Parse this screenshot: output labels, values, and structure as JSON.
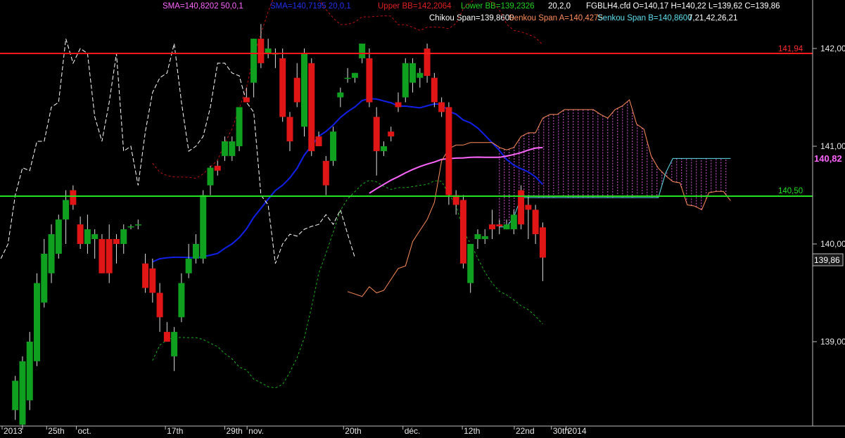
{
  "header": {
    "sma50": "SMA=140,8202  50,0,1",
    "sma20": "SMA=140,7195  20,0,1",
    "upper_bb": "Upper BB=142,2064",
    "lower_bb": "Lower BB=139,2326",
    "bb_params": "20,2,0",
    "instrument": "FGBLH4.cfd O=140,17 H=140,22 L=139,62 C=139,86",
    "chikou": "Chikou Span=139,8600",
    "senkou_a": "Senkou Span A=140,4275",
    "senkou_b": "Senkou Span B=140,8600",
    "ichimoku_params": "7,21,42,26,21"
  },
  "price_tags": {
    "red_line": "141,94",
    "green_line": "140,50",
    "sma_value": "140,82",
    "last_close": "139,86"
  },
  "colors": {
    "background": "#000000",
    "bull": "#10a020",
    "bear": "#e01515",
    "sma20": "#1020e8",
    "sma50": "#ff66ff",
    "upper_bb": "#c01010",
    "lower_bb": "#16b016",
    "chikou": "#ffffff",
    "senkou_a": "#ff8c5a",
    "senkou_b": "#5ee0ee",
    "cloud": "#ff66ff",
    "red_hline": "#ff1a1a",
    "green_hline": "#22e022"
  },
  "chart_data": {
    "type": "candlestick",
    "instrument": "FGBLH4.cfd",
    "y_range": [
      138.35,
      142.5
    ],
    "y_ticks": [
      {
        "value": 142.0,
        "label": "142,00"
      },
      {
        "value": 141.0,
        "label": "141,00"
      },
      {
        "value": 140.0,
        "label": "140,00"
      },
      {
        "value": 139.0,
        "label": "139,00"
      }
    ],
    "x_ticks": [
      {
        "date": "2013-09-17",
        "label": "2013"
      },
      {
        "date": "2013-09-25",
        "label": "25th"
      },
      {
        "date": "2013-10-01",
        "label": "oct."
      },
      {
        "date": "2013-10-17",
        "label": "17th"
      },
      {
        "date": "2013-10-29",
        "label": "29th"
      },
      {
        "date": "2013-11-01",
        "label": "nov."
      },
      {
        "date": "2013-11-20",
        "label": "20th"
      },
      {
        "date": "2013-12-02",
        "label": "déc."
      },
      {
        "date": "2013-12-12",
        "label": "12th"
      },
      {
        "date": "2013-12-22",
        "label": "22nd"
      },
      {
        "date": "2013-12-30",
        "label": "30th"
      },
      {
        "date": "2014-01-01",
        "label": "2014"
      }
    ],
    "hlines": [
      {
        "value": 141.94,
        "label": "141,94",
        "color": "red"
      },
      {
        "value": 140.5,
        "label": "140,50",
        "color": "green"
      }
    ],
    "last_sma_value": 140.82,
    "last_close": 139.86,
    "candles": [
      {
        "o": 138.3,
        "h": 138.65,
        "l": 138.2,
        "c": 138.6
      },
      {
        "o": 138.15,
        "h": 138.85,
        "l": 138.1,
        "c": 138.8
      },
      {
        "o": 138.4,
        "h": 139.1,
        "l": 138.3,
        "c": 139.0
      },
      {
        "o": 138.8,
        "h": 139.7,
        "l": 138.75,
        "c": 139.6
      },
      {
        "o": 139.4,
        "h": 140.05,
        "l": 139.35,
        "c": 139.9
      },
      {
        "o": 139.7,
        "h": 140.2,
        "l": 139.6,
        "c": 140.1
      },
      {
        "o": 139.9,
        "h": 140.3,
        "l": 139.85,
        "c": 140.25
      },
      {
        "o": 140.25,
        "h": 140.55,
        "l": 140.0,
        "c": 140.45
      },
      {
        "o": 140.55,
        "h": 140.6,
        "l": 140.35,
        "c": 140.4
      },
      {
        "o": 140.2,
        "h": 140.28,
        "l": 139.95,
        "c": 140.0
      },
      {
        "o": 140.0,
        "h": 140.3,
        "l": 139.9,
        "c": 140.15
      },
      {
        "o": 140.05,
        "h": 140.15,
        "l": 139.85,
        "c": 140.1
      },
      {
        "o": 140.05,
        "h": 140.1,
        "l": 139.7,
        "c": 139.7
      },
      {
        "o": 140.05,
        "h": 140.2,
        "l": 139.6,
        "c": 139.7
      },
      {
        "o": 140.05,
        "h": 140.1,
        "l": 139.8,
        "c": 140.0
      },
      {
        "o": 140.0,
        "h": 140.2,
        "l": 139.9,
        "c": 140.15
      },
      {
        "o": 140.18,
        "h": 140.2,
        "l": 140.15,
        "c": 140.18
      },
      {
        "o": 140.2,
        "h": 140.25,
        "l": 140.15,
        "c": 140.2
      },
      {
        "o": 139.8,
        "h": 139.9,
        "l": 139.5,
        "c": 139.55
      },
      {
        "o": 139.75,
        "h": 139.85,
        "l": 139.4,
        "c": 139.5
      },
      {
        "o": 139.5,
        "h": 139.6,
        "l": 139.1,
        "c": 139.25
      },
      {
        "o": 139.1,
        "h": 139.2,
        "l": 139.0,
        "c": 139.0
      },
      {
        "o": 138.85,
        "h": 139.15,
        "l": 138.7,
        "c": 139.1
      },
      {
        "o": 139.25,
        "h": 139.7,
        "l": 139.2,
        "c": 139.6
      },
      {
        "o": 139.7,
        "h": 140.0,
        "l": 139.65,
        "c": 139.85
      },
      {
        "o": 139.85,
        "h": 140.1,
        "l": 139.8,
        "c": 140.0
      },
      {
        "o": 139.85,
        "h": 140.55,
        "l": 139.8,
        "c": 140.5
      },
      {
        "o": 140.6,
        "h": 140.8,
        "l": 140.5,
        "c": 140.78
      },
      {
        "o": 140.8,
        "h": 140.85,
        "l": 140.7,
        "c": 140.75
      },
      {
        "o": 140.9,
        "h": 141.1,
        "l": 140.85,
        "c": 141.05
      },
      {
        "o": 140.9,
        "h": 141.1,
        "l": 140.85,
        "c": 141.05
      },
      {
        "o": 141.0,
        "h": 141.25,
        "l": 140.95,
        "c": 141.4
      },
      {
        "o": 141.5,
        "h": 141.6,
        "l": 141.45,
        "c": 141.45
      },
      {
        "o": 141.65,
        "h": 142.1,
        "l": 141.5,
        "c": 142.1
      },
      {
        "o": 142.1,
        "h": 142.25,
        "l": 141.8,
        "c": 141.85
      },
      {
        "o": 141.95,
        "h": 142.1,
        "l": 141.9,
        "c": 142.0
      },
      {
        "o": 141.95,
        "h": 142.0,
        "l": 141.8,
        "c": 141.95
      },
      {
        "o": 141.9,
        "h": 142.0,
        "l": 141.25,
        "c": 141.3
      },
      {
        "o": 141.3,
        "h": 141.35,
        "l": 140.95,
        "c": 141.05
      },
      {
        "o": 141.7,
        "h": 141.85,
        "l": 141.4,
        "c": 141.45
      },
      {
        "o": 141.2,
        "h": 142.0,
        "l": 141.1,
        "c": 141.95
      },
      {
        "o": 141.85,
        "h": 141.9,
        "l": 140.9,
        "c": 140.95
      },
      {
        "o": 141.1,
        "h": 141.15,
        "l": 141.0,
        "c": 141.0
      },
      {
        "o": 140.85,
        "h": 140.9,
        "l": 140.5,
        "c": 140.6
      },
      {
        "o": 140.85,
        "h": 141.2,
        "l": 140.8,
        "c": 141.15
      },
      {
        "o": 141.5,
        "h": 141.6,
        "l": 141.4,
        "c": 141.55
      },
      {
        "o": 141.7,
        "h": 141.8,
        "l": 141.65,
        "c": 141.7
      },
      {
        "o": 141.7,
        "h": 141.75,
        "l": 141.65,
        "c": 141.75
      },
      {
        "o": 141.9,
        "h": 142.05,
        "l": 141.85,
        "c": 142.05
      },
      {
        "o": 141.9,
        "h": 142.0,
        "l": 141.4,
        "c": 141.45
      },
      {
        "o": 141.3,
        "h": 141.4,
        "l": 140.7,
        "c": 140.95
      },
      {
        "o": 140.95,
        "h": 141.05,
        "l": 140.9,
        "c": 141.0
      },
      {
        "o": 141.15,
        "h": 141.2,
        "l": 141.05,
        "c": 141.1
      },
      {
        "o": 141.45,
        "h": 141.55,
        "l": 141.35,
        "c": 141.4
      },
      {
        "o": 141.5,
        "h": 141.9,
        "l": 141.45,
        "c": 141.85
      },
      {
        "o": 141.65,
        "h": 141.9,
        "l": 141.55,
        "c": 141.85
      },
      {
        "o": 141.7,
        "h": 141.8,
        "l": 141.6,
        "c": 141.75
      },
      {
        "o": 142.0,
        "h": 142.05,
        "l": 141.65,
        "c": 141.72
      },
      {
        "o": 141.7,
        "h": 141.75,
        "l": 141.4,
        "c": 141.45
      },
      {
        "o": 141.45,
        "h": 141.5,
        "l": 141.3,
        "c": 141.35
      },
      {
        "o": 141.4,
        "h": 141.45,
        "l": 140.4,
        "c": 140.5
      },
      {
        "o": 140.5,
        "h": 140.55,
        "l": 140.3,
        "c": 140.4
      },
      {
        "o": 140.45,
        "h": 140.5,
        "l": 139.75,
        "c": 139.8
      },
      {
        "o": 139.6,
        "h": 140.0,
        "l": 139.5,
        "c": 140.0
      },
      {
        "o": 140.05,
        "h": 140.15,
        "l": 139.95,
        "c": 140.1
      },
      {
        "o": 140.05,
        "h": 140.15,
        "l": 140.0,
        "c": 140.08
      },
      {
        "o": 140.2,
        "h": 140.35,
        "l": 140.05,
        "c": 140.15
      },
      {
        "o": 140.2,
        "h": 140.25,
        "l": 140.1,
        "c": 140.18
      },
      {
        "o": 140.15,
        "h": 140.25,
        "l": 140.15,
        "c": 140.2
      },
      {
        "o": 140.15,
        "h": 140.35,
        "l": 140.1,
        "c": 140.3
      },
      {
        "o": 140.55,
        "h": 140.6,
        "l": 140.15,
        "c": 140.2
      },
      {
        "o": 140.4,
        "h": 140.5,
        "l": 140.05,
        "c": 140.35
      },
      {
        "o": 140.35,
        "h": 140.4,
        "l": 140.0,
        "c": 140.1
      },
      {
        "o": 140.17,
        "h": 140.22,
        "l": 139.62,
        "c": 139.86
      }
    ]
  }
}
